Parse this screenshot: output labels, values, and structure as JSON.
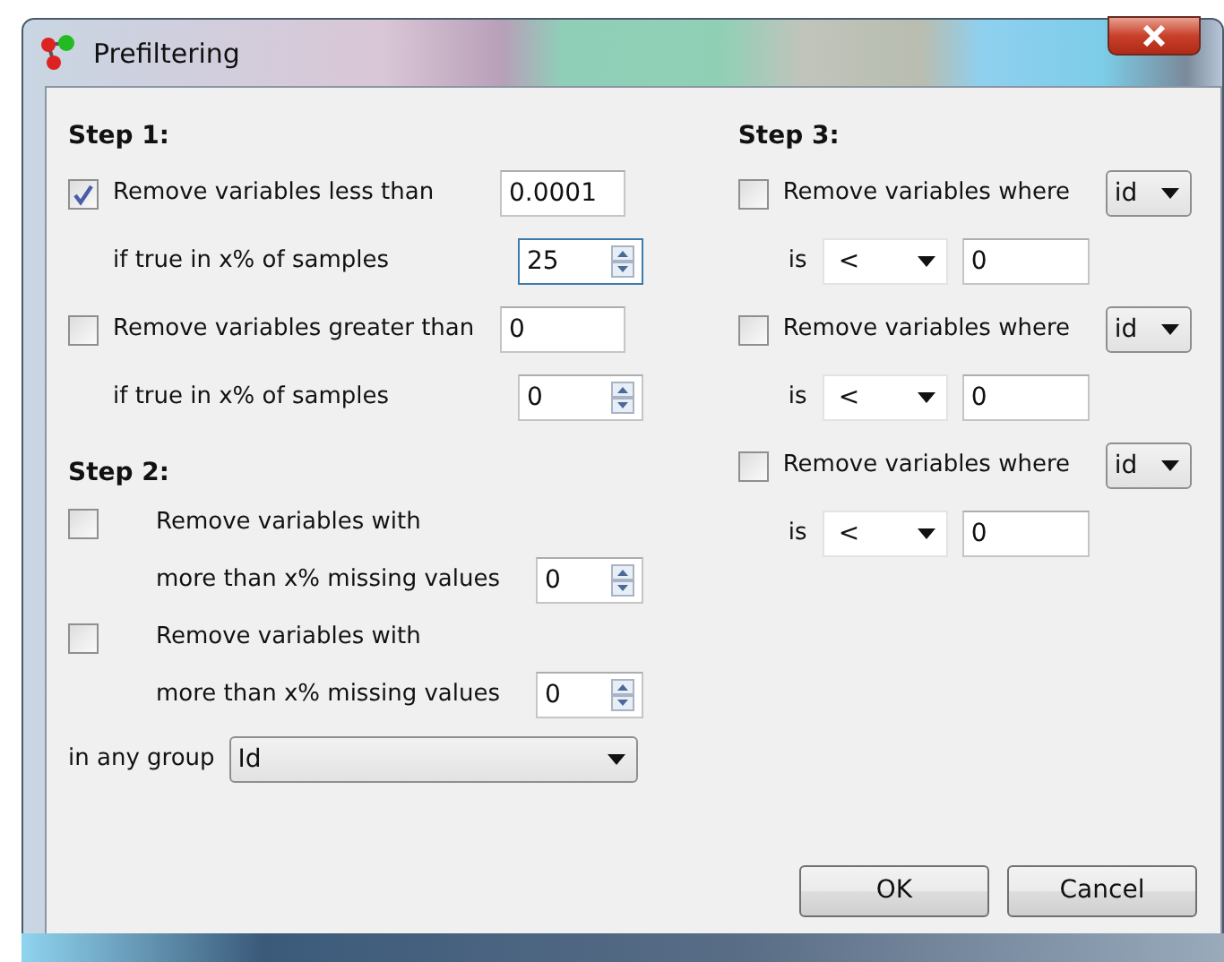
{
  "window": {
    "title": "Prefiltering"
  },
  "step1": {
    "heading": "Step 1:",
    "rules": [
      {
        "label": "Remove variables less than",
        "checked": true,
        "value": "0.0001",
        "sublabel": "if true in x% of samples",
        "percent": "25",
        "focused": true
      },
      {
        "label": "Remove variables greater than",
        "checked": false,
        "value": "0",
        "sublabel": "if true in x% of samples",
        "percent": "0",
        "focused": false
      }
    ]
  },
  "step2": {
    "heading": "Step 2:",
    "rules": [
      {
        "label": "Remove variables with",
        "checked": false,
        "sublabel": "more than x% missing values",
        "percent": "0"
      },
      {
        "label": "Remove variables with",
        "checked": false,
        "sublabel": "more than x% missing values",
        "percent": "0"
      }
    ],
    "group_label": "in any group",
    "group_value": "Id"
  },
  "step3": {
    "heading": "Step 3:",
    "rules": [
      {
        "label": "Remove variables where",
        "checked": false,
        "column": "id",
        "is_label": "is",
        "operator": "<",
        "value": "0"
      },
      {
        "label": "Remove variables where",
        "checked": false,
        "column": "id",
        "is_label": "is",
        "operator": "<",
        "value": "0"
      },
      {
        "label": "Remove variables where",
        "checked": false,
        "column": "id",
        "is_label": "is",
        "operator": "<",
        "value": "0"
      }
    ]
  },
  "buttons": [
    "OK",
    "Cancel"
  ]
}
